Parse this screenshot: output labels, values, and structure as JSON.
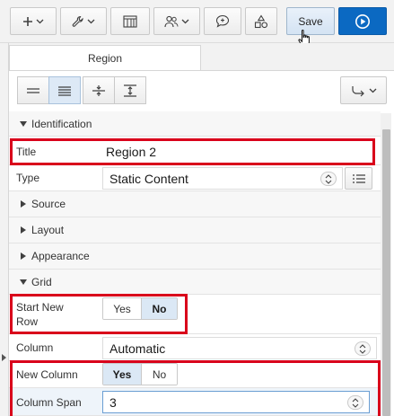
{
  "toolbar": {
    "save_label": "Save",
    "buttons": [
      "add-icon",
      "wrench-icon",
      "layout-grid-icon",
      "users-icon",
      "comment-icon",
      "shapes-icon",
      "run-icon"
    ]
  },
  "tabs": [
    {
      "label": "Region",
      "active": true
    }
  ],
  "sections": {
    "identification": "Identification",
    "source": "Source",
    "layout": "Layout",
    "appearance": "Appearance",
    "grid": "Grid"
  },
  "properties": {
    "title": {
      "label": "Title",
      "value": "Region 2"
    },
    "type": {
      "label": "Type",
      "value": "Static Content"
    },
    "start_new_row": {
      "label": "Start New Row",
      "options": [
        "Yes",
        "No"
      ],
      "selected": "No"
    },
    "column": {
      "label": "Column",
      "value": "Automatic"
    },
    "new_column": {
      "label": "New Column",
      "options": [
        "Yes",
        "No"
      ],
      "selected": "Yes"
    },
    "column_span": {
      "label": "Column Span",
      "value": "3"
    }
  },
  "colors": {
    "highlight": "#d9001b",
    "run_button": "#0b69c2",
    "selected_segment": "#dbe8f5"
  }
}
